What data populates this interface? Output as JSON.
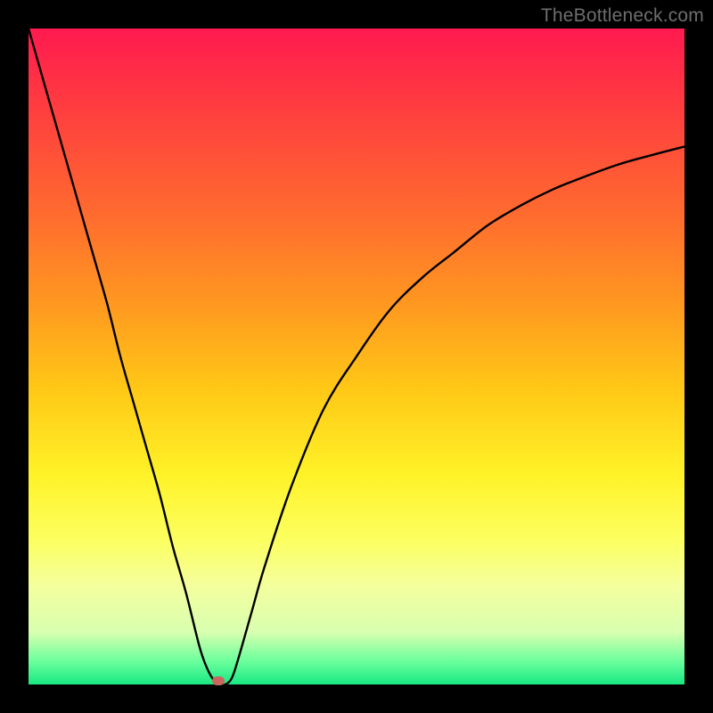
{
  "watermark": "TheBottleneck.com",
  "chart_data": {
    "type": "line",
    "title": "",
    "xlabel": "",
    "ylabel": "",
    "xlim": [
      0,
      100
    ],
    "ylim": [
      0,
      100
    ],
    "series": [
      {
        "name": "bottleneck-curve",
        "x": [
          0,
          2,
          4,
          6,
          8,
          10,
          12,
          14,
          16,
          18,
          20,
          22,
          24,
          26,
          27,
          28,
          29,
          30,
          31,
          32,
          34,
          36,
          40,
          45,
          50,
          55,
          60,
          65,
          70,
          75,
          80,
          85,
          90,
          95,
          100
        ],
        "y": [
          100,
          93,
          86,
          79,
          72,
          65,
          58,
          50,
          43,
          36,
          29,
          21,
          14,
          6,
          3,
          1,
          0,
          0,
          1,
          4,
          11,
          18,
          30,
          42,
          50,
          57,
          62,
          66,
          70,
          73,
          75.5,
          77.5,
          79.3,
          80.7,
          82
        ]
      }
    ],
    "marker": {
      "x": 29,
      "y": 0.5
    },
    "gradient_stops": [
      {
        "pct": 0,
        "color": "#ff1a50"
      },
      {
        "pct": 10,
        "color": "#ff3742"
      },
      {
        "pct": 28,
        "color": "#ff6a2f"
      },
      {
        "pct": 42,
        "color": "#ff9820"
      },
      {
        "pct": 55,
        "color": "#ffc816"
      },
      {
        "pct": 68,
        "color": "#fff228"
      },
      {
        "pct": 78,
        "color": "#fcff60"
      },
      {
        "pct": 85,
        "color": "#f4ff9e"
      },
      {
        "pct": 92,
        "color": "#d8ffb0"
      },
      {
        "pct": 96.5,
        "color": "#6aff9c"
      },
      {
        "pct": 100,
        "color": "#18e884"
      }
    ]
  }
}
